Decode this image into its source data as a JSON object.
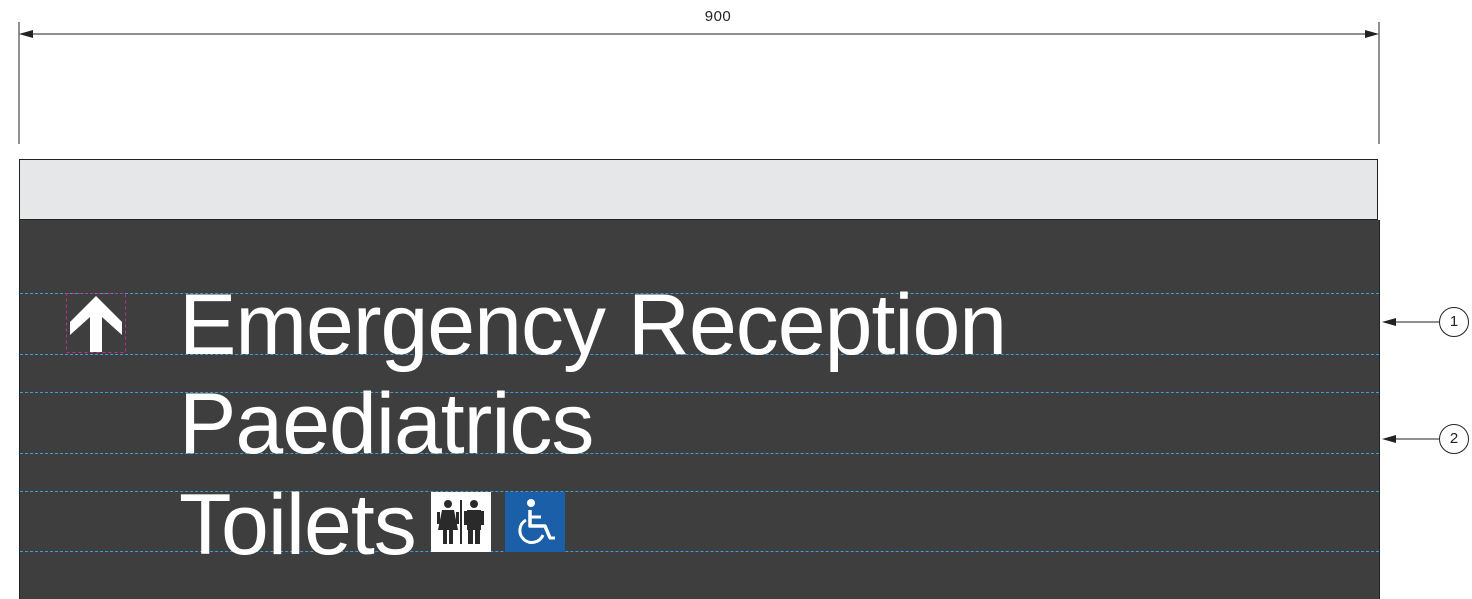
{
  "dimension": {
    "label": "900"
  },
  "sign": {
    "lines": [
      {
        "text": "Emergency Reception"
      },
      {
        "text": "Paediatrics"
      },
      {
        "text": "Toilets"
      }
    ],
    "icons": [
      "arrow-up-icon",
      "toilets-male-female-icon",
      "accessible-wheelchair-icon"
    ],
    "colors": {
      "panel": "#3f3e3e",
      "header": "#e6e7e8",
      "text": "#ffffff",
      "accessible": "#1a5fa8",
      "guides": "#3aa0dc"
    }
  },
  "callouts": [
    {
      "number": "1"
    },
    {
      "number": "2"
    }
  ]
}
